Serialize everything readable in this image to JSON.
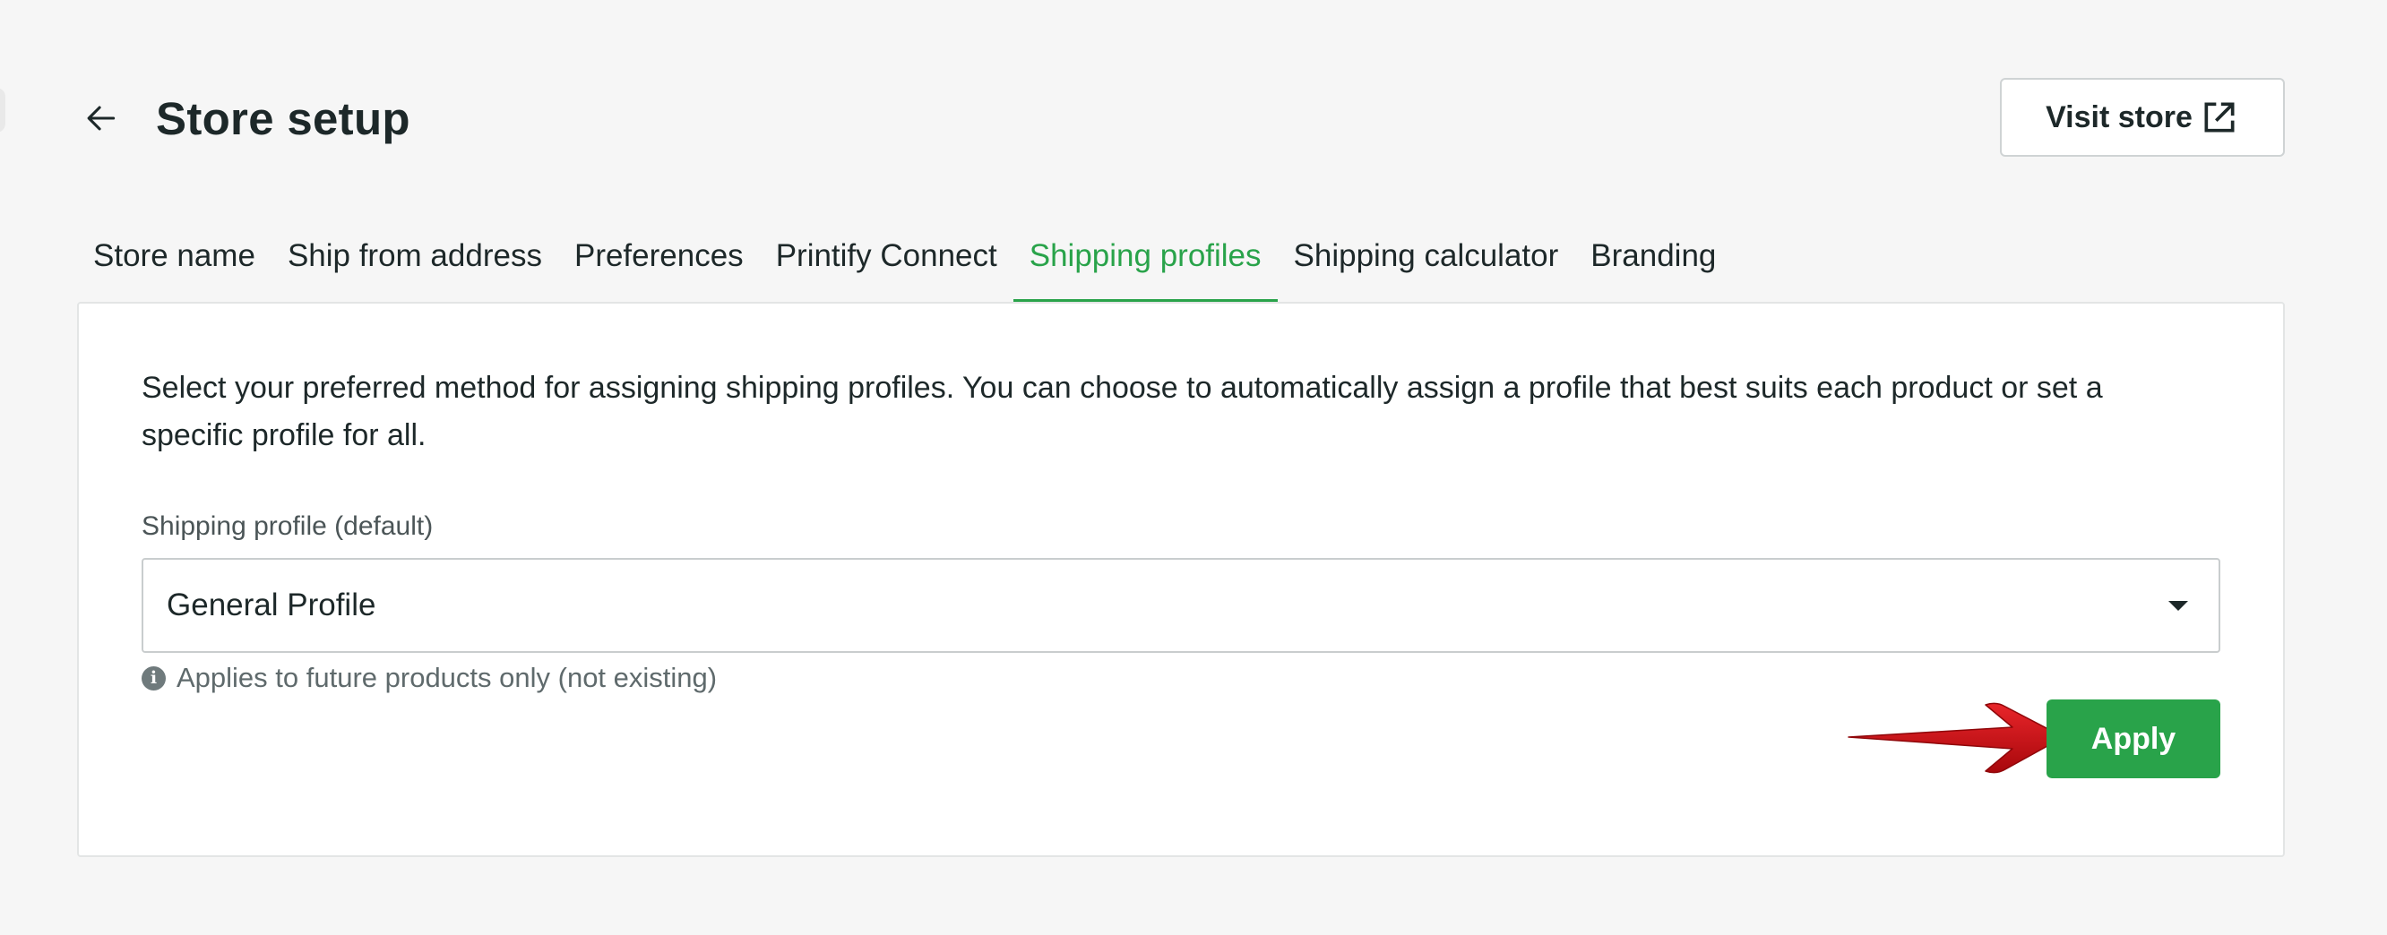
{
  "header": {
    "title": "Store setup",
    "visit_store_label": "Visit store"
  },
  "tabs": [
    {
      "label": "Store name",
      "active": false
    },
    {
      "label": "Ship from address",
      "active": false
    },
    {
      "label": "Preferences",
      "active": false
    },
    {
      "label": "Printify Connect",
      "active": false
    },
    {
      "label": "Shipping profiles",
      "active": true
    },
    {
      "label": "Shipping calculator",
      "active": false
    },
    {
      "label": "Branding",
      "active": false
    }
  ],
  "panel": {
    "description": "Select your preferred method for assigning shipping profiles. You can choose to automatically assign a profile that best suits each product or set a specific profile for all.",
    "field_label": "Shipping profile (default)",
    "selected_value": "General Profile",
    "hint": "Applies to future products only (not existing)",
    "apply_label": "Apply"
  },
  "icons": {
    "back": "arrow-left-icon",
    "external": "external-link-icon",
    "dropdown": "caret-down-icon",
    "info": "info-icon",
    "annotation": "red-arrow-icon"
  },
  "colors": {
    "accent": "#29a34a",
    "background": "#f6f6f6",
    "text": "#1d2829",
    "annotation_arrow": "#d10f14"
  }
}
